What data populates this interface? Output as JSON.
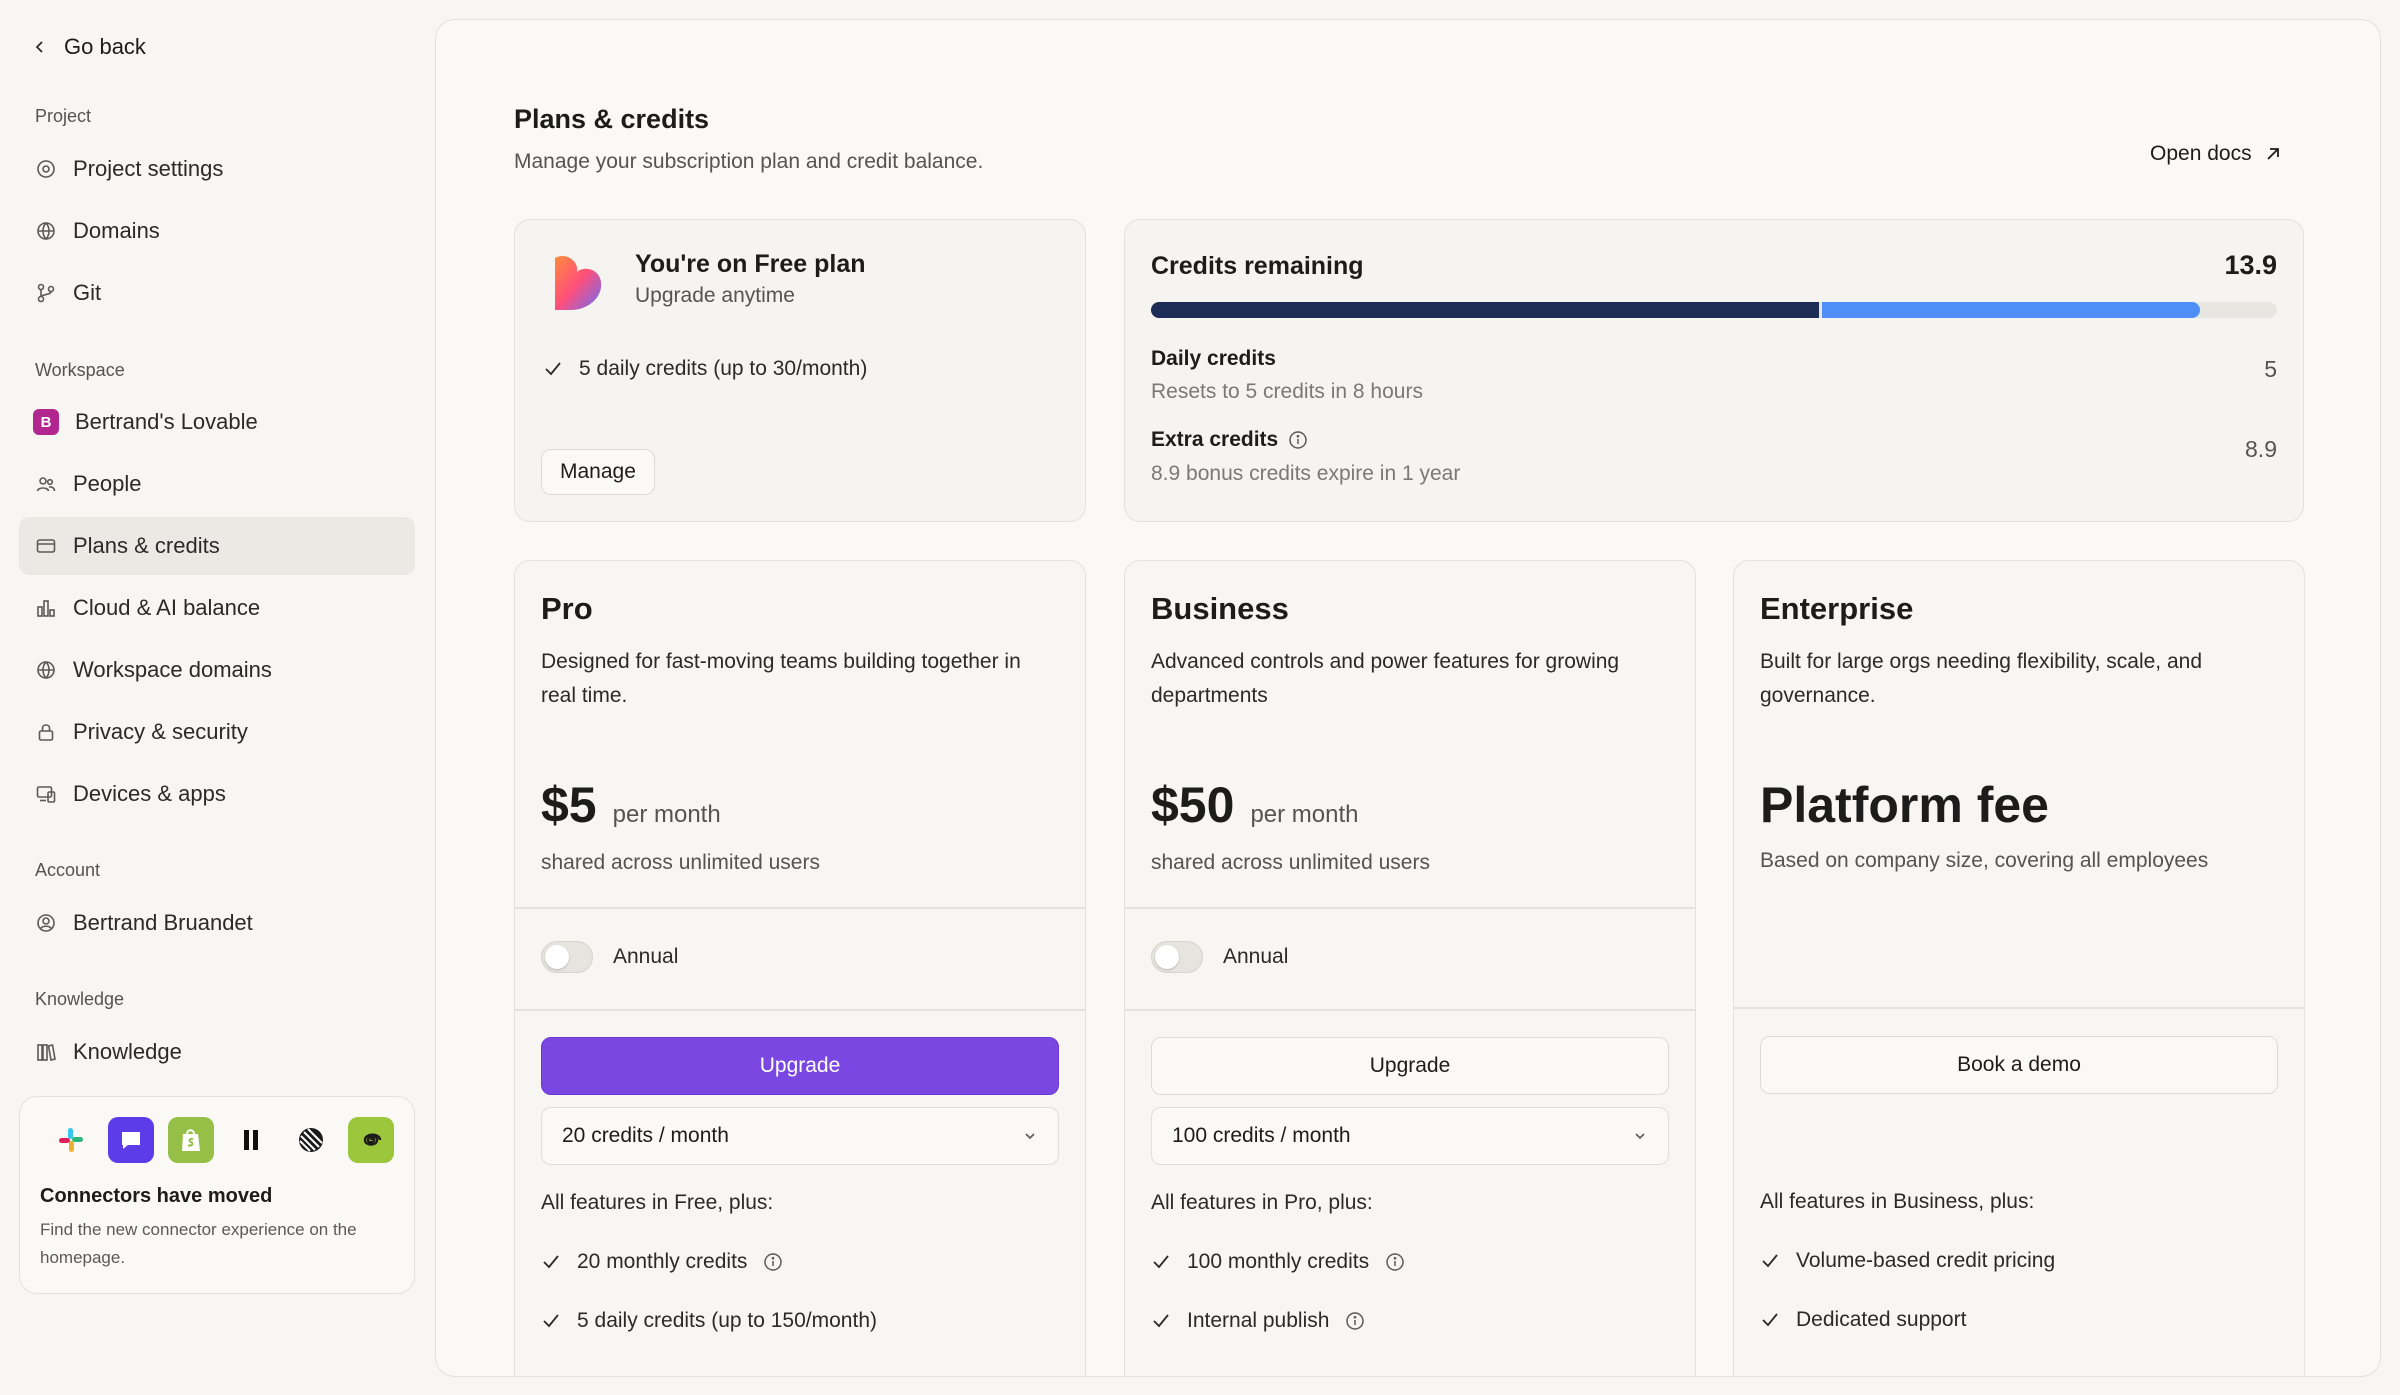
{
  "sidebar": {
    "go_back": "Go back",
    "sections": {
      "project": "Project",
      "workspace": "Workspace",
      "account": "Account",
      "knowledge": "Knowledge"
    },
    "items": {
      "project_settings": "Project settings",
      "domains": "Domains",
      "git": "Git",
      "workspace_name": "Bertrand's Lovable",
      "workspace_initial": "B",
      "people": "People",
      "plans_credits": "Plans & credits",
      "cloud_ai": "Cloud & AI balance",
      "workspace_domains": "Workspace domains",
      "privacy_security": "Privacy & security",
      "devices_apps": "Devices & apps",
      "account_user": "Bertrand Bruandet",
      "knowledge": "Knowledge"
    },
    "connectors": {
      "title": "Connectors have moved",
      "desc": "Find the new connector experience on the homepage.",
      "icons": [
        "slack-icon",
        "chat-icon",
        "shopify-icon",
        "linear-pause-icon",
        "stripe-like-icon",
        "spiral-icon"
      ]
    }
  },
  "main": {
    "title": "Plans & credits",
    "subtitle": "Manage your subscription plan and credit balance.",
    "open_docs": "Open docs",
    "current_plan": {
      "name": "You're on Free plan",
      "upsell": "Upgrade anytime",
      "feature": "5 daily credits (up to 30/month)",
      "manage": "Manage"
    },
    "credits": {
      "title": "Credits remaining",
      "total": "13.9",
      "daily_fraction": 0.593,
      "extra_fraction": 0.336,
      "daily_label": "Daily credits",
      "daily_sub": "Resets to 5 credits in 8 hours",
      "daily_value": "5",
      "extra_label": "Extra credits",
      "extra_sub": "8.9 bonus credits expire in 1 year",
      "extra_value": "8.9"
    },
    "tiers": {
      "pro": {
        "name": "Pro",
        "desc": "Designed for fast-moving teams building together in real time.",
        "price": "$5",
        "per": "per month",
        "shared": "shared across unlimited users",
        "annual": "Annual",
        "cta": "Upgrade",
        "select": "20 credits / month",
        "features_head": "All features in Free, plus:",
        "features": [
          "20 monthly credits",
          "5 daily credits (up to 150/month)"
        ]
      },
      "business": {
        "name": "Business",
        "desc": "Advanced controls and power features for growing departments",
        "price": "$50",
        "per": "per month",
        "shared": "shared across unlimited users",
        "annual": "Annual",
        "cta": "Upgrade",
        "select": "100 credits / month",
        "features_head": "All features in Pro, plus:",
        "features": [
          "100 monthly credits",
          "Internal publish"
        ]
      },
      "enterprise": {
        "name": "Enterprise",
        "desc": "Built for large orgs needing flexibility, scale, and governance.",
        "price": "Platform fee",
        "shared": "Based on company size, covering all employees",
        "cta": "Book a demo",
        "features_head": "All features in Business, plus:",
        "features": [
          "Volume-based credit pricing",
          "Dedicated support"
        ]
      }
    },
    "colors": {
      "accent": "#7b47e3",
      "bar_daily": "#1d2d56",
      "bar_extra": "#4f8ef7",
      "active_bg": "#ebe9e4"
    }
  }
}
